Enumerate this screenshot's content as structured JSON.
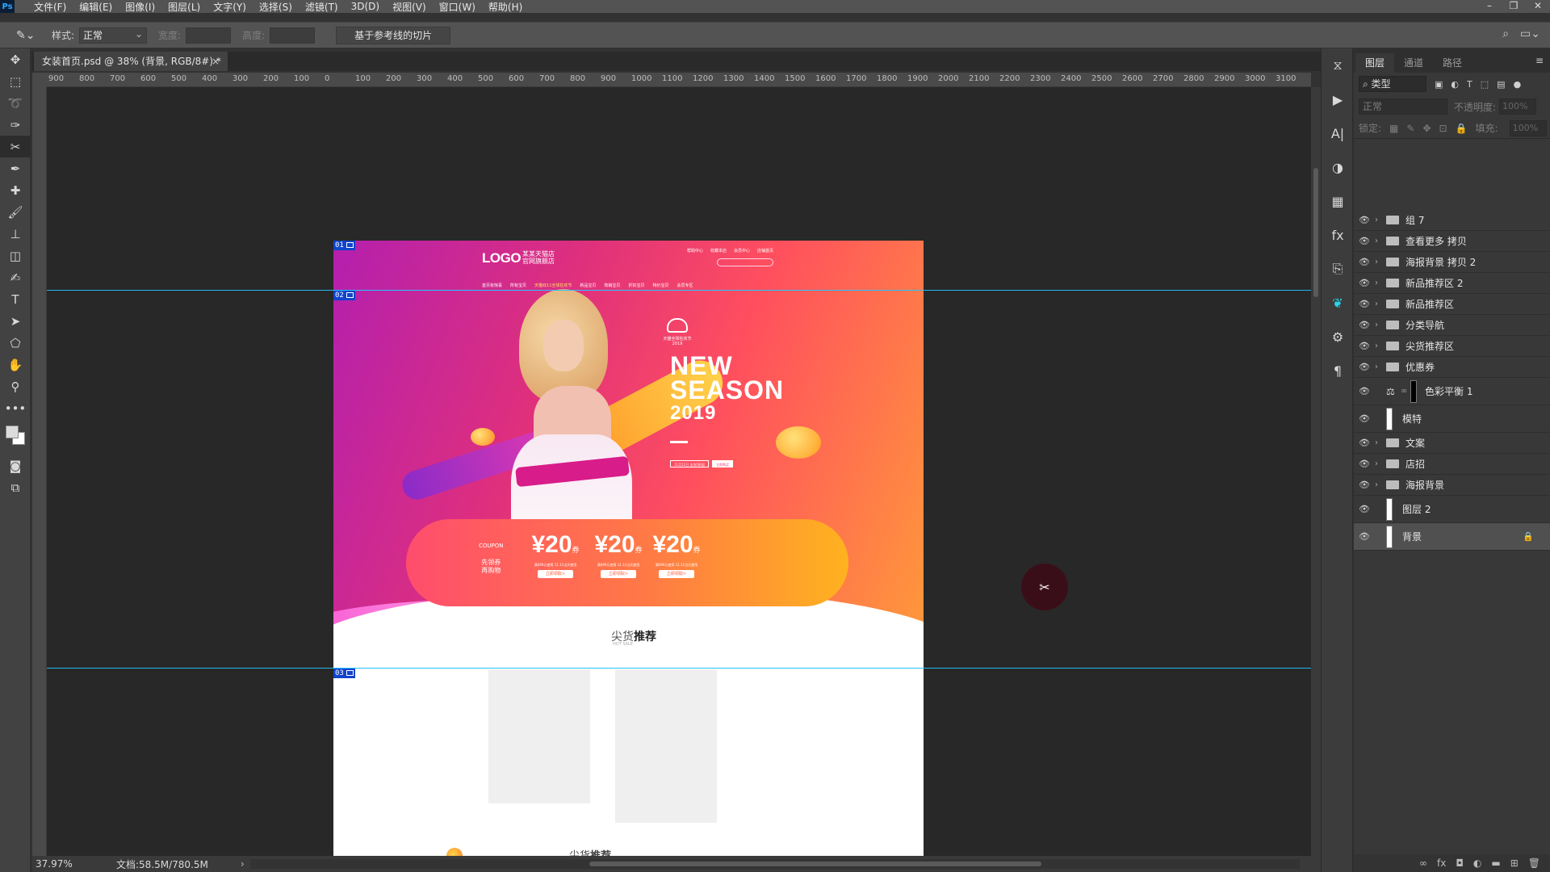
{
  "app": {
    "logo": "Ps"
  },
  "menu": [
    "文件(F)",
    "编辑(E)",
    "图像(I)",
    "图层(L)",
    "文字(Y)",
    "选择(S)",
    "滤镜(T)",
    "3D(D)",
    "视图(V)",
    "窗口(W)",
    "帮助(H)"
  ],
  "window_controls": [
    "–",
    "❐",
    "✕"
  ],
  "options": {
    "style_label": "样式:",
    "style_value": "正常",
    "width_label": "宽度:",
    "height_label": "高度:",
    "slice_button": "基于参考线的切片"
  },
  "document": {
    "tab_title": "女装首页.psd @ 38% (背景, RGB/8#) *",
    "close": "×"
  },
  "ruler_h_labels": [
    "900",
    "800",
    "700",
    "600",
    "500",
    "400",
    "300",
    "200",
    "100",
    "0",
    "100",
    "200",
    "300",
    "400",
    "500",
    "600",
    "700",
    "800",
    "900",
    "1000",
    "1100",
    "1200",
    "1300",
    "1400",
    "1500",
    "1600",
    "1700",
    "1800",
    "1900",
    "2000",
    "2100",
    "2200",
    "2300",
    "2400",
    "2500",
    "2600",
    "2700",
    "2800",
    "2900",
    "3000",
    "3100"
  ],
  "artboard": {
    "slices": [
      "01",
      "02",
      "03"
    ],
    "logo": "LOGO",
    "store_name": "某某天猫店 官网旗舰店",
    "top_links": [
      "帮助中心",
      "收藏本店",
      "会员中心",
      "店铺首页"
    ],
    "nav": [
      "首页有惊喜",
      "所有宝贝",
      "天猫双11全球狂欢节",
      "新品宝贝",
      "热销宝贝",
      "折扣宝贝",
      "特价宝贝",
      "会员专区"
    ],
    "badge": "天猫全球狂欢节",
    "badge_sub": "2019",
    "headline_1": "NEW",
    "headline_2": "SEASON",
    "year": "2019",
    "cta_1": "11月11日 全场5折起",
    "cta_2": "立即购买",
    "coupon_label": "COUPON",
    "coupon_text_1": "先领券",
    "coupon_text_2": "再购物",
    "coupons": [
      {
        "amount": "¥20",
        "unit": "券",
        "note": "满499元使用\n11.11当天使用",
        "button": "立即领取>"
      },
      {
        "amount": "¥20",
        "unit": "券",
        "note": "满499元使用\n11.11当天使用",
        "button": "立即领取>"
      },
      {
        "amount": "¥20",
        "unit": "券",
        "note": "满499元使用\n11.11当天使用",
        "button": "立即领取>"
      }
    ],
    "section_title_a": "尖货",
    "section_title_b": "推荐",
    "section_sub": "HOT SALE",
    "bottom_title_a": "尖货",
    "bottom_title_b": "推荐"
  },
  "status": {
    "zoom": "37.97%",
    "doc": "文档:58.5M/780.5M",
    "arrow": "›"
  },
  "layers_panel": {
    "tabs": [
      "图层",
      "通道",
      "路径"
    ],
    "filter_label": "类型",
    "blend_mode": "正常",
    "opacity_label": "不透明度:",
    "opacity_value": "100%",
    "lock_label": "锁定:",
    "fill_label": "填充:",
    "fill_value": "100%",
    "layers": [
      {
        "name": "组 7",
        "type": "group"
      },
      {
        "name": "查看更多 拷贝",
        "type": "group"
      },
      {
        "name": "海报背景 拷贝 2",
        "type": "group"
      },
      {
        "name": "新品推荐区 2",
        "type": "group"
      },
      {
        "name": "新品推荐区",
        "type": "group"
      },
      {
        "name": "分类导航",
        "type": "group"
      },
      {
        "name": "尖货推荐区",
        "type": "group"
      },
      {
        "name": "优惠券",
        "type": "group"
      },
      {
        "name": "色彩平衡 1",
        "type": "adjustment"
      },
      {
        "name": "模特",
        "type": "pixel"
      },
      {
        "name": "文案",
        "type": "group"
      },
      {
        "name": "店招",
        "type": "group"
      },
      {
        "name": "海报背景",
        "type": "group"
      },
      {
        "name": "图层 2",
        "type": "pixel"
      },
      {
        "name": "背景",
        "type": "background",
        "locked": true
      }
    ]
  },
  "colors": {
    "accent_guide": "#27c4ff",
    "slice_tag": "#1144cc",
    "panel_bg": "#383838"
  }
}
